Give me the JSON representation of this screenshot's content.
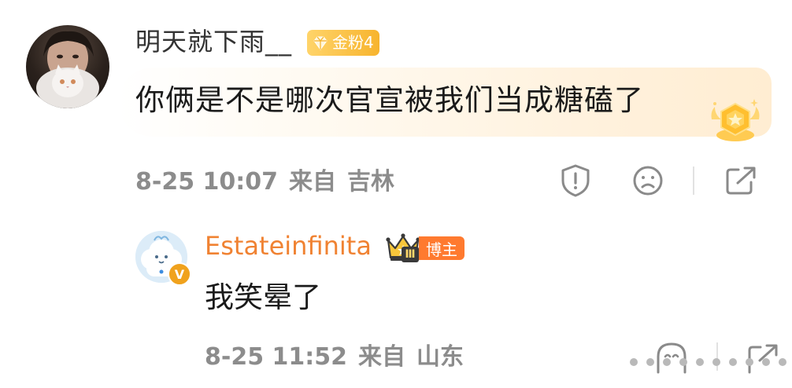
{
  "main_comment": {
    "username": "明天就下雨__",
    "fan_badge": {
      "label": "金粉4",
      "color": "#f7b42e"
    },
    "content": "你俩是不是哪次官宣被我们当成糖磕了",
    "time": "8-25 10:07",
    "source": "来自",
    "location": "吉林",
    "actions": {
      "report": "report-icon",
      "dislike": "sad-face-icon",
      "share": "share-icon"
    }
  },
  "reply": {
    "username": "Estateinfinita",
    "username_color": "#f08232",
    "verify_badge": "V",
    "level_badge": "Ⅲ",
    "role_badge": "博主",
    "content": "我笑晕了",
    "time": "8-25 11:52",
    "source": "来自",
    "location": "山东",
    "actions": {
      "dislike": "smile-face-icon",
      "share": "share-icon"
    }
  }
}
